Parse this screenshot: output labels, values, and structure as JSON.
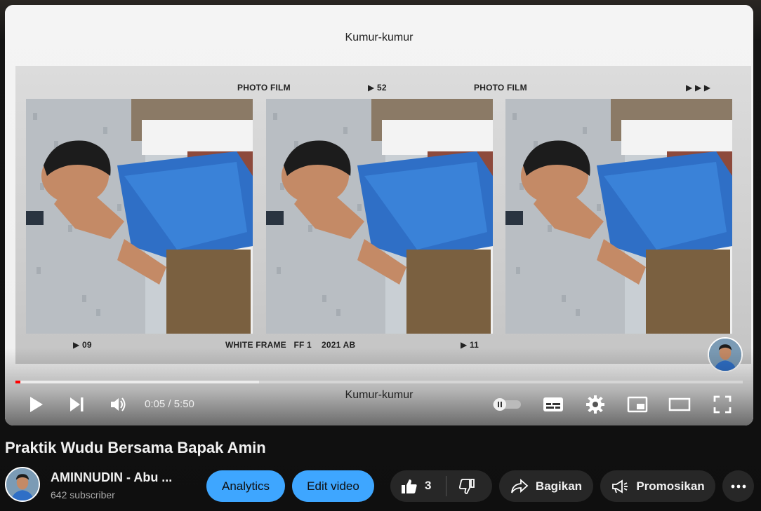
{
  "video": {
    "caption_top": "Kumur-kumur",
    "caption_bottom": "Kumur-kumur",
    "film": {
      "label_left": "PHOTO FILM",
      "label_num": "▶ 52",
      "label_right": "PHOTO FILM",
      "label_arrows": "▶ ▶ ▶",
      "bottom_num1": "▶ 09",
      "bottom_text": "WHITE FRAME   FF 1    2021 AB",
      "bottom_num2": "▶ 11"
    }
  },
  "player": {
    "time": "0:05 / 5:50",
    "progress_played_fraction": 0.007,
    "progress_loaded_fraction": 0.335,
    "icons": [
      "play-icon",
      "next-icon",
      "volume-icon",
      "autoplay-toggle-icon",
      "subtitles-icon",
      "settings-icon",
      "miniplayer-icon",
      "theater-icon",
      "fullscreen-icon"
    ]
  },
  "title": "Praktik Wudu Bersama Bapak Amin",
  "channel": {
    "name": "AMINNUDIN - Abu ...",
    "subscribers": "642 subscriber"
  },
  "actions": {
    "analytics": "Analytics",
    "edit_video": "Edit video",
    "like_count": "3",
    "share": "Bagikan",
    "promote": "Promosikan",
    "more_icon": "more-horizontal-icon"
  },
  "colors": {
    "accent_blue": "#3ea6ff",
    "progress_red": "#ff0000",
    "dark_button": "#272727"
  }
}
